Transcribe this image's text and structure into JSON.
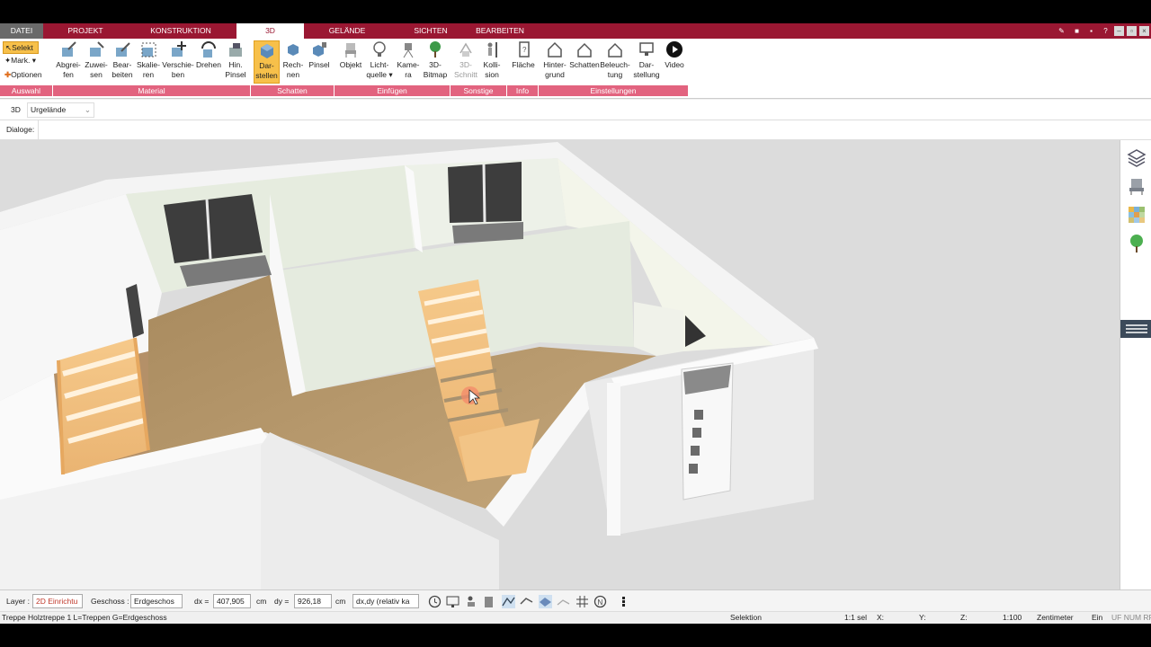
{
  "tabs": [
    {
      "label": "DATEI"
    },
    {
      "label": "PROJEKT"
    },
    {
      "label": "KONSTRUKTION"
    },
    {
      "label": "3D"
    },
    {
      "label": "GELÄNDE"
    },
    {
      "label": "SICHTEN"
    },
    {
      "label": "BEARBEITEN"
    }
  ],
  "selection": {
    "selekt": "Selekt",
    "mark": "Mark.",
    "optionen": "Optionen"
  },
  "ribbon": {
    "buttons": [
      {
        "l1": "Abgrei-",
        "l2": "fen"
      },
      {
        "l1": "Zuwei-",
        "l2": "sen"
      },
      {
        "l1": "Bear-",
        "l2": "beiten"
      },
      {
        "l1": "Skalie-",
        "l2": "ren"
      },
      {
        "l1": "Verschie-",
        "l2": "ben"
      },
      {
        "l1": "Drehen",
        "l2": ""
      },
      {
        "l1": "Hin.",
        "l2": "Pinsel"
      },
      {
        "l1": "Dar-",
        "l2": "stellen"
      },
      {
        "l1": "Rech-",
        "l2": "nen"
      },
      {
        "l1": "Pinsel",
        "l2": ""
      },
      {
        "l1": "Objekt",
        "l2": ""
      },
      {
        "l1": "Licht-",
        "l2": "quelle"
      },
      {
        "l1": "Kame-",
        "l2": "ra"
      },
      {
        "l1": "3D-",
        "l2": "Bitmap"
      },
      {
        "l1": "3D-",
        "l2": "Schnitt"
      },
      {
        "l1": "Kolli-",
        "l2": "sion"
      },
      {
        "l1": "Fläche",
        "l2": ""
      },
      {
        "l1": "Hinter-",
        "l2": "grund"
      },
      {
        "l1": "Schatten",
        "l2": ""
      },
      {
        "l1": "Beleuch-",
        "l2": "tung"
      },
      {
        "l1": "Dar-",
        "l2": "stellung"
      },
      {
        "l1": "Video",
        "l2": ""
      }
    ],
    "groups": [
      "Auswahl",
      "Material",
      "Schatten",
      "Einfügen",
      "Sonstige",
      "Info",
      "Einstellungen"
    ]
  },
  "view_bar": {
    "mode": "3D",
    "terrain": "Urgelände"
  },
  "dialog_bar": {
    "label": "Dialoge:"
  },
  "bottom": {
    "layer_label": "Layer :",
    "layer_value": "2D Einrichtu",
    "floor_label": "Geschoss :",
    "floor_value": "Erdgeschos",
    "dx_label": "dx =",
    "dx_value": "407,905",
    "dx_unit": "cm",
    "dy_label": "dy =",
    "dy_value": "926,18",
    "dy_unit": "cm",
    "coord_mode": "dx,dy (relativ ka"
  },
  "status": {
    "message": "Treppe Holztreppe 1 L=Treppen G=Erdgeschoss",
    "mode": "Selektion",
    "selcount": "1:1 sel",
    "x": "X:",
    "y": "Y:",
    "z": "Z:",
    "scale": "1:100",
    "unit": "Zentimeter",
    "ein": "Ein",
    "flags": "UF NUM RF"
  },
  "colors": {
    "brand": "#9a1732",
    "group": "#e2637f",
    "active": "#f7c04a"
  },
  "icons": [
    "layers-icon",
    "furniture-icon",
    "material-palette-icon",
    "tree-icon"
  ]
}
